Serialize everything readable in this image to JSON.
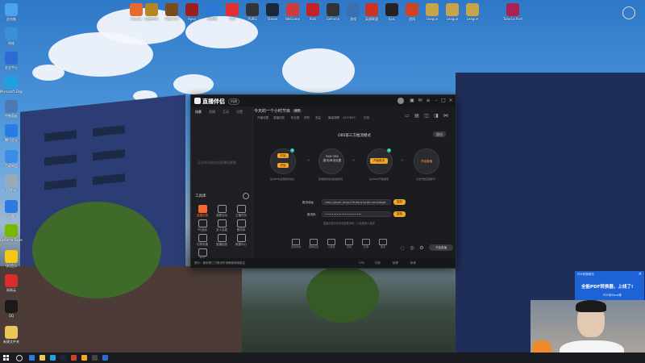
{
  "desktop": {
    "top_icons": [
      {
        "label": "Google",
        "color": "#e9692c"
      },
      {
        "label": "魔兽世界",
        "color": "#b38824"
      },
      {
        "label": "World of",
        "color": "#7a4c1c"
      },
      {
        "label": "Apex",
        "color": "#9a2020"
      },
      {
        "label": "加速器",
        "color": "#2b78d6"
      },
      {
        "label": "360",
        "color": "#e23030"
      },
      {
        "label": "PUBG",
        "color": "#333333"
      },
      {
        "label": "Steam",
        "color": "#1b2838"
      },
      {
        "label": "WeGame",
        "color": "#d03b3b"
      },
      {
        "label": "Riot",
        "color": "#c8202a"
      },
      {
        "label": "GeForce",
        "color": "#333333"
      },
      {
        "label": "游戏",
        "color": "#3c6fb0"
      },
      {
        "label": "英雄联盟",
        "color": "#c32"
      },
      {
        "label": "Epic",
        "color": "#222222"
      },
      {
        "label": "战网",
        "color": "#c42"
      },
      {
        "label": "League",
        "color": "#c7a44b"
      },
      {
        "label": "League",
        "color": "#c7a44b"
      },
      {
        "label": "League",
        "color": "#c7a44b"
      },
      {
        "label": "Tutorial Part",
        "color": "#aa2255"
      }
    ],
    "left_icons": [
      {
        "label": "此电脑",
        "color": "#4aa3f0"
      },
      {
        "label": "网络",
        "color": "#3b8fd8"
      },
      {
        "label": "安全中心",
        "color": "#2d6bd4"
      },
      {
        "label": "Microsoft Edge",
        "color": "#1fa0e0"
      },
      {
        "label": "控制面板",
        "color": "#4b79b3"
      },
      {
        "label": "腾讯会议",
        "color": "#2a7be4"
      },
      {
        "label": "百度网盘",
        "color": "#3d8be8"
      },
      {
        "label": "回收站",
        "color": "#9ab"
      },
      {
        "label": "迅雷",
        "color": "#2d7ae2"
      },
      {
        "label": "GeForce Experience",
        "color": "#76b900"
      },
      {
        "label": "QQ音乐",
        "color": "#f5c518"
      },
      {
        "label": "网易云",
        "color": "#d92c2c"
      },
      {
        "label": "QQ",
        "color": "#1a1a1a"
      },
      {
        "label": "新建文件夹",
        "color": "#e7c65a"
      }
    ]
  },
  "app": {
    "name": "直播伴侣",
    "badge": "内测",
    "left_tabs": [
      "场景",
      "直播",
      "互动",
      "设置"
    ],
    "left_hint": "还没有添加任何直播场景哦",
    "tools_title": "工具库",
    "tools": [
      {
        "label": "直播设置"
      },
      {
        "label": "观看互动"
      },
      {
        "label": "主播任务"
      },
      {
        "label": "PK连线"
      },
      {
        "label": "多人连麦"
      },
      {
        "label": "素材库"
      },
      {
        "label": "礼物设置"
      },
      {
        "label": "直播回放"
      },
      {
        "label": "数据中心"
      },
      {
        "label": "更多"
      }
    ],
    "header": {
      "title": "今天的一个小时节目",
      "tag": "编辑",
      "sub": [
        "开播设置",
        "直播回放",
        "粉丝数",
        "获赞",
        "收益"
      ],
      "stats": [
        "最高观看",
        "4237853",
        "在线"
      ]
    },
    "panel_title": "OBS第三方推流模式",
    "exit_label": "退出",
    "steps": [
      {
        "buttons": [
          "开始",
          "开始"
        ],
        "label": "在OBS中设置推流地址",
        "badge": "1"
      },
      {
        "buttons": [],
        "text": "PAM OBS\n推流/串流设置",
        "label": "复制推流地址和推流码"
      },
      {
        "buttons": [
          "开始推流"
        ],
        "label": "在OBS中开始推流",
        "badge": "3"
      },
      {
        "buttons": [
          "开始直播"
        ],
        "label": "点击开始直播即可"
      }
    ],
    "fields": [
      {
        "label": "推流地址",
        "value": "rtmp://push-rtmp-l26.douyincdn.com/stage",
        "button": "复制"
      },
      {
        "label": "推流码",
        "value": "••••••••••••••••••••••",
        "button": "复制"
      }
    ],
    "field_hint": "直播过程中请勿泄露推流码，以免被他人盗用",
    "bottom_icons": [
      "道具商城",
      "观看设置",
      "小游戏",
      "互动",
      "礼物",
      "更多"
    ],
    "start_live": "开始直播",
    "status_left": "提示：使用第三方推流时请确保网络稳定",
    "status_items": [
      "CPU",
      "内存",
      "帧率",
      "码率"
    ]
  },
  "ad": {
    "title": "PDF转换助手",
    "line1": "全能PDF转换器，上线了!",
    "line2": "PDF转Word等"
  }
}
